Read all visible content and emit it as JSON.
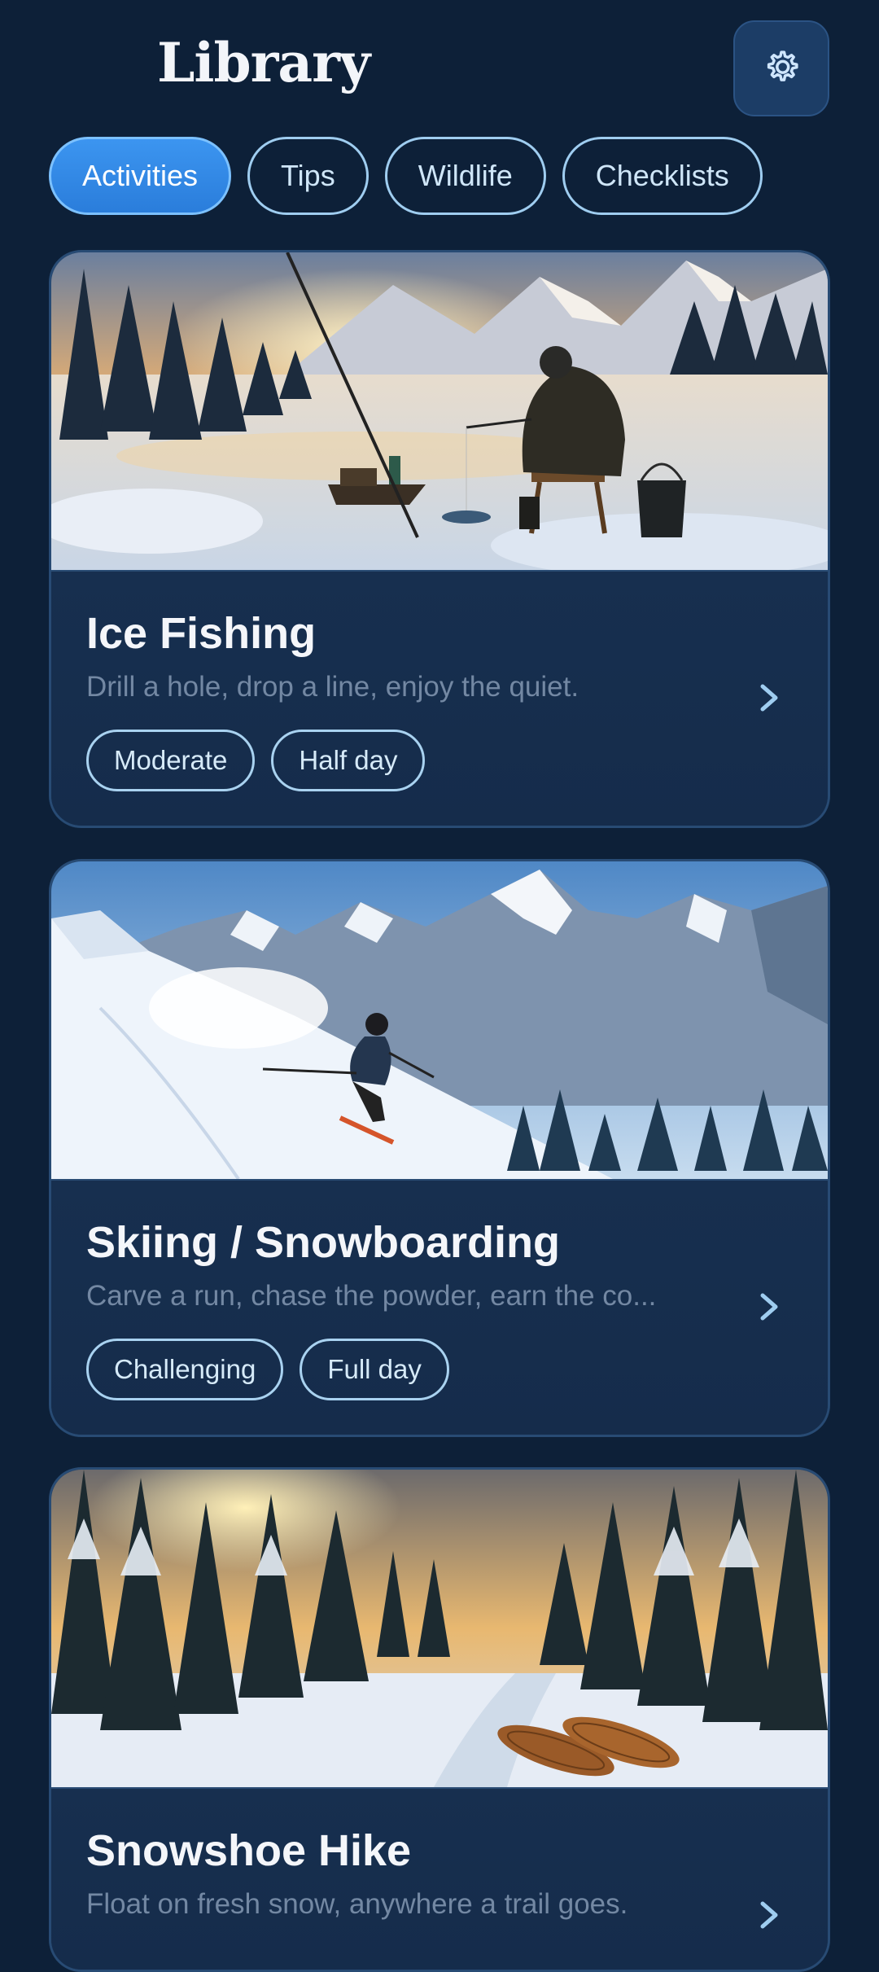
{
  "header": {
    "title": "Library",
    "settings_icon": "gear-icon"
  },
  "tabs": [
    {
      "label": "Activities",
      "active": true
    },
    {
      "label": "Tips",
      "active": false
    },
    {
      "label": "Wildlife",
      "active": false
    },
    {
      "label": "Checklists",
      "active": false
    }
  ],
  "cards": [
    {
      "title": "Ice Fishing",
      "description": "Drill a hole, drop a line, enjoy the quiet.",
      "tags": [
        "Moderate",
        "Half day"
      ],
      "image": "ice-fishing-illustration"
    },
    {
      "title": "Skiing / Snowboarding",
      "description": "Carve a run, chase the powder, earn the co...",
      "tags": [
        "Challenging",
        "Full day"
      ],
      "image": "skiing-illustration"
    },
    {
      "title": "Snowshoe Hike",
      "description": "Float on fresh snow, anywhere a trail goes.",
      "tags": [],
      "image": "snowshoe-illustration"
    }
  ],
  "colors": {
    "background": "#0d2038",
    "card": "#15304f",
    "accent": "#3c95f0",
    "outline": "#9fcdf0"
  }
}
